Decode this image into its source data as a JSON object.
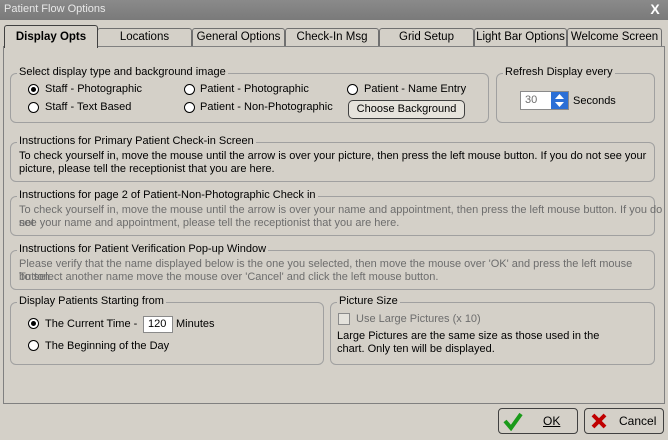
{
  "window": {
    "title": "Patient Flow Options",
    "close_glyph": "X"
  },
  "tabs": [
    {
      "label": "Display Opts"
    },
    {
      "label": "Locations"
    },
    {
      "label": "General Options"
    },
    {
      "label": "Check-In Msg"
    },
    {
      "label": "Grid Setup"
    },
    {
      "label": "Light Bar Options"
    },
    {
      "label": "Welcome Screen"
    }
  ],
  "display_type": {
    "legend": "Select display type and background image",
    "options": [
      {
        "label": "Staff - Photographic",
        "selected": true
      },
      {
        "label": "Staff - Text Based",
        "selected": false
      },
      {
        "label": "Patient - Photographic",
        "selected": false
      },
      {
        "label": "Patient - Non-Photographic",
        "selected": false
      },
      {
        "label": "Patient - Name Entry",
        "selected": false
      }
    ],
    "choose_background": "Choose Background"
  },
  "refresh": {
    "legend": "Refresh Display every",
    "value": "30",
    "unit": "Seconds"
  },
  "primary": {
    "legend": "Instructions for Primary Patient Check-in Screen",
    "line1": "To check yourself in, move the mouse until the arrow is over your picture, then press the left mouse button.  If you do not see your",
    "line2": "picture, please tell the receptionist that you are here."
  },
  "page2": {
    "legend": "Instructions for page 2 of Patient-Non-Photographic Check in",
    "line1": "To check yourself in, move the mouse until the arrow is over your name and appointment, then press the left mouse button.  If you do not",
    "line2": "see your name and appointment, please tell the receptionist that you are here."
  },
  "verify": {
    "legend": "Instructions for Patient Verification Pop-up Window",
    "line1": "Please verify that the name displayed below is the one you selected, then move the mouse over 'OK' and press the left mouse button.",
    "line2": "To select another name move the mouse over 'Cancel' and click the left mouse button."
  },
  "starting": {
    "legend": "Display Patients Starting from",
    "current_label": "The Current Time  -",
    "minutes_value": "120",
    "minutes_label": "Minutes",
    "beginning_label": "The Beginning of the Day"
  },
  "picture": {
    "legend": "Picture Size",
    "checkbox_label": "Use Large Pictures (x 10)",
    "note1": "Large Pictures are the same size as those used in the",
    "note2": "chart.  Only ten will be displayed."
  },
  "buttons": {
    "ok": "OK",
    "cancel": "Cancel"
  },
  "colors": {
    "ok_check": "#1a9a1a",
    "cancel_x": "#c00000"
  }
}
